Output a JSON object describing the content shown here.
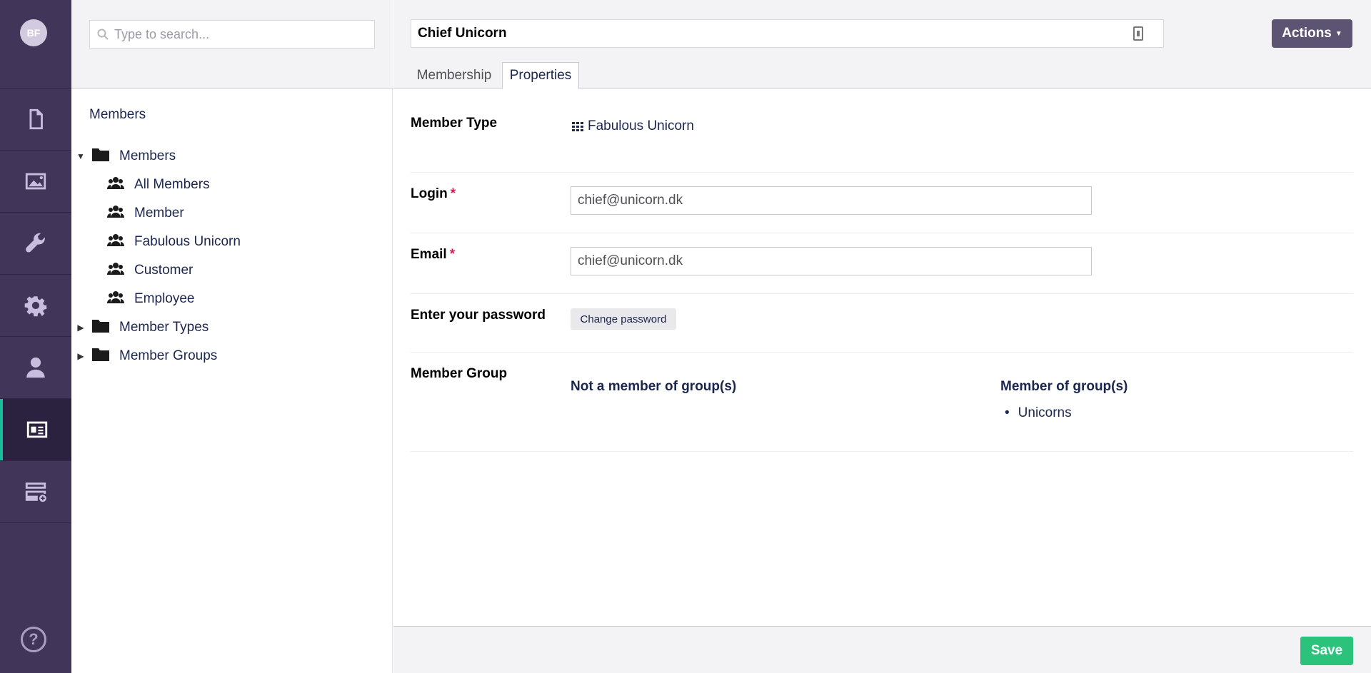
{
  "user": {
    "initials": "BF"
  },
  "rail": {
    "items": [
      {
        "icon": "document-icon"
      },
      {
        "icon": "media-icon"
      },
      {
        "icon": "wrench-icon"
      },
      {
        "icon": "gear-icon"
      },
      {
        "icon": "user-icon"
      },
      {
        "icon": "member-card-icon",
        "active": true
      },
      {
        "icon": "forms-icon"
      }
    ],
    "help_label": "?"
  },
  "tree": {
    "search_placeholder": "Type to search...",
    "title": "Members",
    "nodes": [
      {
        "label": "Members",
        "type": "folder",
        "expanded": true
      },
      {
        "label": "All Members",
        "type": "group"
      },
      {
        "label": "Member",
        "type": "group"
      },
      {
        "label": "Fabulous Unicorn",
        "type": "group"
      },
      {
        "label": "Customer",
        "type": "group"
      },
      {
        "label": "Employee",
        "type": "group"
      },
      {
        "label": "Member Types",
        "type": "folder",
        "expanded": false
      },
      {
        "label": "Member Groups",
        "type": "folder",
        "expanded": false
      }
    ]
  },
  "editor": {
    "name": "Chief Unicorn",
    "actions_label": "Actions",
    "tabs": [
      {
        "label": "Membership",
        "active": false
      },
      {
        "label": "Properties",
        "active": true
      }
    ],
    "properties": {
      "member_type_label": "Member Type",
      "member_type_value": "Fabulous Unicorn",
      "login_label": "Login",
      "login_value": "chief@unicorn.dk",
      "email_label": "Email",
      "email_value": "chief@unicorn.dk",
      "required_mark": "*",
      "password_label": "Enter your password",
      "change_password_label": "Change password",
      "member_group_label": "Member Group",
      "not_member_heading": "Not a member of group(s)",
      "member_heading": "Member of group(s)",
      "member_groups": [
        "Unicorns"
      ]
    },
    "save_label": "Save"
  }
}
